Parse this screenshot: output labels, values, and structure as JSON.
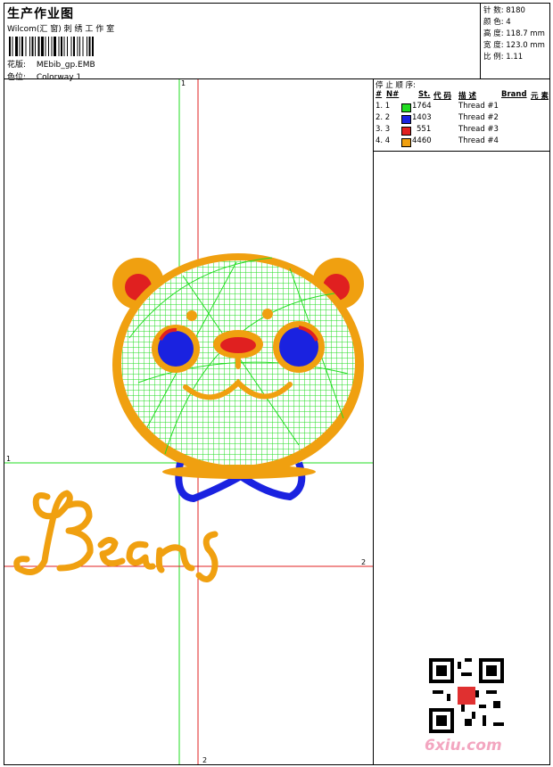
{
  "header": {
    "title": "生产作业图",
    "subtitle": "Wilcom(汇 窗) 刺 绣 工 作 室",
    "design_label": "花版:",
    "design_value": "MEbib_gp.EMB",
    "colorway_label": "色位:",
    "colorway_value": "Colorway 1"
  },
  "stats": {
    "stitches": "针 数: 8180",
    "colors": "颜 色: 4",
    "height": "高 度: 118.7 mm",
    "width": "宽 度: 123.0 mm",
    "scale": "比 例: 1.11"
  },
  "sequence": {
    "heading": "停 止 顺 序:",
    "columns": [
      "#",
      "N#",
      "St.",
      "代 码",
      "描 述",
      "Brand",
      "元 素"
    ],
    "rows": [
      {
        "num": "1. 1",
        "color": "#22dd22",
        "stitches": "1764",
        "desc": "Thread #1"
      },
      {
        "num": "2. 2",
        "color": "#1a22e0",
        "stitches": "1403",
        "desc": "Thread #2"
      },
      {
        "num": "3. 3",
        "color": "#e02020",
        "stitches": "551",
        "desc": "Thread #3"
      },
      {
        "num": "4. 4",
        "color": "#f0a010",
        "stitches": "4460",
        "desc": "Thread #4"
      }
    ]
  },
  "axes": {
    "v1": "1",
    "v2": "2",
    "h1": "1",
    "h2": "2"
  },
  "design_text": "Bears",
  "watermark": "6xiu.com",
  "colors": {
    "green": "#22dd22",
    "blue": "#1a22e0",
    "red": "#e02020",
    "orange": "#f0a010"
  }
}
